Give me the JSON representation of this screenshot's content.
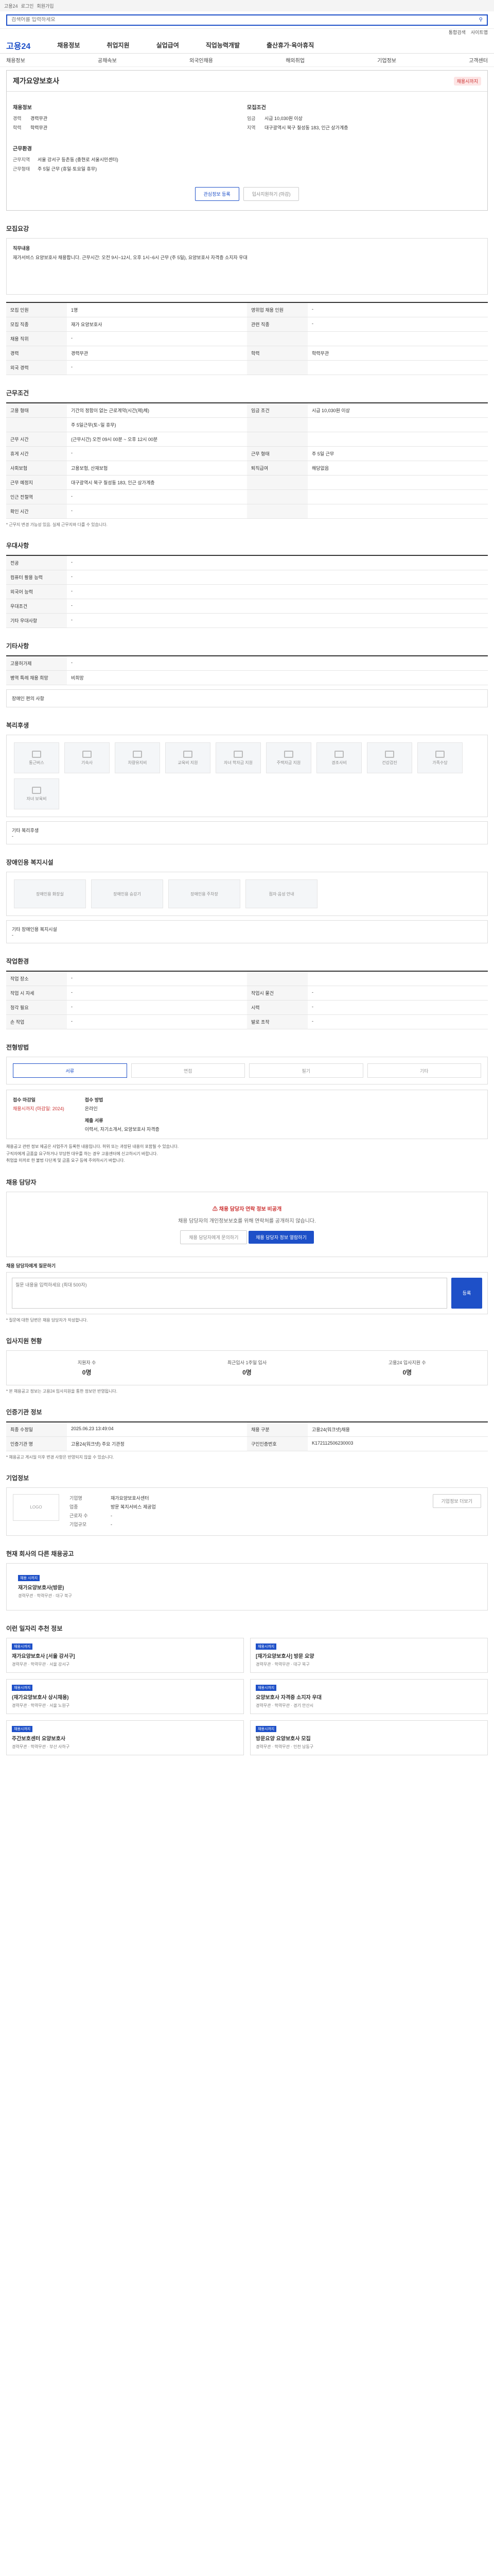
{
  "topbar": {
    "items": [
      "고용24",
      "로그인",
      "회원가입"
    ]
  },
  "search": {
    "placeholder": "검색어를 입력하세요"
  },
  "util": [
    "통합검색",
    "사이트맵"
  ],
  "gnb": {
    "logo": "고용24",
    "items": [
      "채용정보",
      "취업지원",
      "실업급여",
      "직업능력개발",
      "출산휴가·육아휴직"
    ]
  },
  "lnb": [
    "채용정보",
    "공채속보",
    "외국인채용",
    "해외취업",
    "기업정보",
    "고객센터"
  ],
  "header": {
    "title": "제가요양보호사",
    "status": "채용시까지",
    "left_label": "채용정보",
    "left_kv": [
      {
        "k": "경력",
        "v": "경력무관"
      },
      {
        "k": "학력",
        "v": "학력무관"
      }
    ],
    "left_label2": "근무환경",
    "left_kv2": [
      {
        "k": "근무지역",
        "v": "서울 강서구 등촌동 (충현로 서울시민센터)"
      },
      {
        "k": "근무형태",
        "v": "주 5일 근무 (휴일·토요일 휴무)"
      }
    ],
    "right_label": "모집조건",
    "right_kv": [
      {
        "k": "임금",
        "v": "시급 10,030원 이상"
      },
      {
        "k": "지역",
        "v": "대구광역시 북구 칠성동 183, 인근 상가계층"
      }
    ],
    "btn_save": "관심정보 등록",
    "btn_apply": "입사지원하기 (마감)"
  },
  "sections": {
    "recruit_info": "모집요강",
    "duty_label": "직무내용",
    "duty_text": "재가서비스 요양보호사 채용합니다. 근무시간: 오전 9시~12시, 오후 1시~6시 근무 (주 5일), 요양보호사 자격증 소지자 우대",
    "recruit_rows": [
      {
        "k": "모집 인원",
        "v": "1명",
        "k2": "영위업 채용 인원",
        "v2": "-"
      },
      {
        "k": "모집 직종",
        "v": "재가 요양보호사",
        "k2": "관련 직종",
        "v2": "-"
      },
      {
        "k": "채용 직위",
        "v": "-",
        "k2": "",
        "v2": ""
      },
      {
        "k": "경력",
        "v": "경력무관",
        "k2": "학력",
        "v2": "학력무관"
      },
      {
        "k": "외국 경력",
        "v": "-",
        "k2": "",
        "v2": ""
      }
    ],
    "work_title": "근무조건",
    "work_rows": [
      {
        "k": "고용 형태",
        "v": "기간의 정함이 없는 근로계약(시간(제)체)",
        "k2": "임금 조건",
        "v2": "시급 10,030원 이상"
      },
      {
        "k": "",
        "v": "주 5일근무(토~일 휴무)",
        "k2": "",
        "v2": ""
      },
      {
        "k": "근무 시간",
        "v": "(근무시간) 오전 09시 00분 ~ 오후 12시 00분",
        "k2": "",
        "v2": ""
      },
      {
        "k": "휴게 시간",
        "v": "-",
        "k2": "근무 형태",
        "v2": "주 5일 근무"
      },
      {
        "k": "사회보험",
        "v": "고용보험, 산재보험",
        "k2": "퇴직급여",
        "v2": "해당없음"
      },
      {
        "k": "근무 예정지",
        "v": "대구광역시 북구 칠성동 183, 인근 상가계층",
        "k2": "",
        "v2": ""
      },
      {
        "k": "인근 전철역",
        "v": "-",
        "k2": "",
        "v2": ""
      },
      {
        "k": "확인 시간",
        "v": "-",
        "k2": "",
        "v2": ""
      }
    ],
    "work_note": "* 근무지 변경 가능성 있음. 실제 근무지와 다를 수 있습니다.",
    "pref_title": "우대사항",
    "pref_rows": [
      {
        "k": "전공",
        "v": "-"
      },
      {
        "k": "컴퓨터 활용 능력",
        "v": "-"
      },
      {
        "k": "외국어 능력",
        "v": "-"
      },
      {
        "k": "우대조건",
        "v": "-"
      },
      {
        "k": "기타 우대사항",
        "v": "-"
      }
    ],
    "etc_title": "기타사항",
    "etc_rows": [
      {
        "k": "고용허가제",
        "v": "-"
      },
      {
        "k": "병역 특례 채용 희망",
        "v": "비희망"
      }
    ],
    "disability_label": "장애인 편의 사항",
    "welfare_title": "복리후생",
    "welfare_cards": [
      "통근버스",
      "기숙사",
      "차량유지비",
      "교육비 지원",
      "자녀 학자금 지원",
      "주택자금 지원",
      "경조사비",
      "건강검진",
      "가족수당",
      "자녀 보육비"
    ],
    "welfare_sub": "기타 복리후생",
    "barrier_title": "장애인용 복지시설",
    "barrier_cards": [
      "장애인용 화장실",
      "장애인용 승강기",
      "장애인용 주차장",
      "점자·음성 안내"
    ],
    "barrier_sub": "기타 장애인용 복지시설",
    "env_title": "작업환경",
    "env_rows": [
      {
        "k": "작업 장소",
        "v": "-",
        "k2": "",
        "v2": ""
      },
      {
        "k": "작업 시 자세",
        "v": "-",
        "k2": "작업시 물건",
        "v2": "-"
      },
      {
        "k": "청각 필요",
        "v": "-",
        "k2": "시력",
        "v2": "-"
      },
      {
        "k": "손 작업",
        "v": "-",
        "k2": "발로 조작",
        "v2": "-"
      }
    ],
    "process_title": "전형방법",
    "process_steps": [
      "서류",
      "면접",
      "필기",
      "기타"
    ],
    "apply_deadline_label": "접수 마감일",
    "apply_deadline": "채용시까지 (마감일: 2024)",
    "apply_method_label": "접수 방법",
    "apply_method": "온라인",
    "apply_docs_label": "제출 서류",
    "apply_docs": "이력서, 자기소개서, 요양보호사 자격증",
    "cautions": [
      "채용공고 관련 정보 제공은 사업주가 등록한 내용입니다. 허위 또는 과장된 내용이 포함될 수 있습니다.",
      "구직자에게 금품을 요구하거나 부당한 대우를 하는 경우 고용센터에 신고하시기 바랍니다.",
      "취업을 미끼로 한 불법 다단계 및 금품 요구 등에 주의하시기 바랍니다."
    ],
    "contact_title": "채용 담당자",
    "contact_warn": "채용 담당자 연락 정보 비공개",
    "contact_text": "채용 담당자의 개인정보보호를 위해 연락처를 공개하지 않습니다.",
    "contact_btn1": "채용 담당자에게 문의하기",
    "contact_btn2": "채용 담당자 정보 열람하기",
    "qa_title": "채용 담당자에게 질문하기",
    "qa_placeholder": "질문 내용을 입력하세요 (최대 500자)",
    "qa_btn": "등록",
    "qa_note": "* 질문에 대한 답변은 채용 담당자가 작성합니다.",
    "stats_title": "입사지원 현황",
    "stats": [
      {
        "k": "지원자 수",
        "v": "0명"
      },
      {
        "k": "최근입사 1주일 입사",
        "v": "0명"
      },
      {
        "k": "고용24 입사지원 수",
        "v": "0명"
      }
    ],
    "stats_note": "* 본 채용공고 정보는 고용24 입사지원을 통한 정보만 반영됩니다.",
    "meta_title": "인증기관 정보",
    "meta_rows": [
      {
        "k": "최종 수정일",
        "v": "2025.06.23 13:49:04",
        "k2": "채용 구분",
        "v2": "고용24(워크넷)채용"
      },
      {
        "k": "인증기관 명",
        "v": "고용24(워크넷) 주요 기관정",
        "k2": "구인인증번호",
        "v2": "K172112506230003"
      }
    ],
    "meta_note": "* 채용공고 게시일 이후 변경 사항은 반영되지 않을 수 있습니다.",
    "company_title": "기업정보",
    "company_logo": "LOGO",
    "company_rows": [
      {
        "k": "기업명",
        "v": "재가요양보호사센터"
      },
      {
        "k": "업종",
        "v": "방문 복지서비스 제공업"
      },
      {
        "k": "근로자 수",
        "v": "-"
      },
      {
        "k": "기업규모",
        "v": "-"
      }
    ],
    "company_btn": "기업정보 더보기",
    "other_title": "현재 회사의 다른 채용공고",
    "other_sub": "다른 공고",
    "other_card_tag": "채용 시까지",
    "other_card_title": "재가요양보호사(방문)",
    "other_card_meta": "경력무관 · 학력무관 · 대구 북구",
    "rec_title": "이런 일자리 추천 정보",
    "rec_cards": [
      {
        "tag": "채용시까지",
        "title": "재가요양보호사 [서울 강서구]",
        "meta": "경력무관 · 학력무관 · 서울 강서구"
      },
      {
        "tag": "채용시까지",
        "title": "[재가요양보호사] 방문 요양",
        "meta": "경력무관 · 학력무관 · 대구 북구"
      },
      {
        "tag": "채용시까지",
        "title": "(재가요양보호사 상시채용)",
        "meta": "경력무관 · 학력무관 · 서울 노원구"
      },
      {
        "tag": "채용시까지",
        "title": "요양보호사 자격증 소지자 우대",
        "meta": "경력무관 · 학력무관 · 경기 안산시"
      },
      {
        "tag": "채용시까지",
        "title": "주간보호센터 요양보호사",
        "meta": "경력무관 · 학력무관 · 부산 사하구"
      },
      {
        "tag": "채용시까지",
        "title": "방문요양 요양보호사 모집",
        "meta": "경력무관 · 학력무관 · 인천 남동구"
      }
    ]
  }
}
